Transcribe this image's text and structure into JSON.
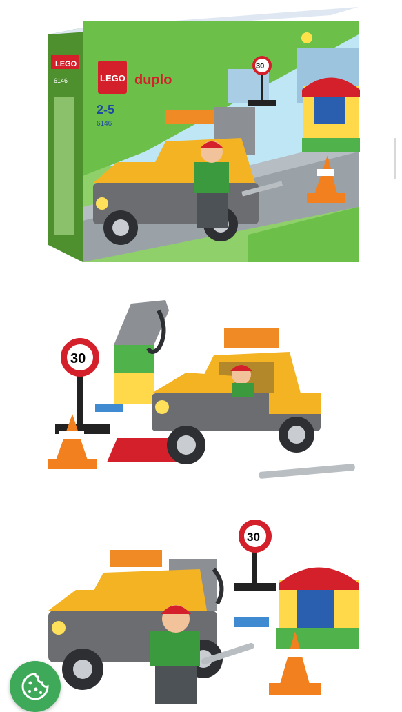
{
  "gallery": {
    "box": {
      "brand_lego": "LEGO",
      "brand_duplo": "duplo",
      "age_range": "2-5",
      "set_number": "6146",
      "side_set_number": "6146",
      "speed_sign": "30"
    },
    "photo2": {
      "speed_sign": "30"
    },
    "photo3": {
      "speed_sign": "30"
    }
  },
  "colors": {
    "truck_yellow": "#f3b323",
    "truck_grey": "#6b6d70",
    "box_green": "#6cc04a",
    "cookie_button": "#3fa95a"
  },
  "icons": {
    "cookie": "cookie-icon"
  }
}
